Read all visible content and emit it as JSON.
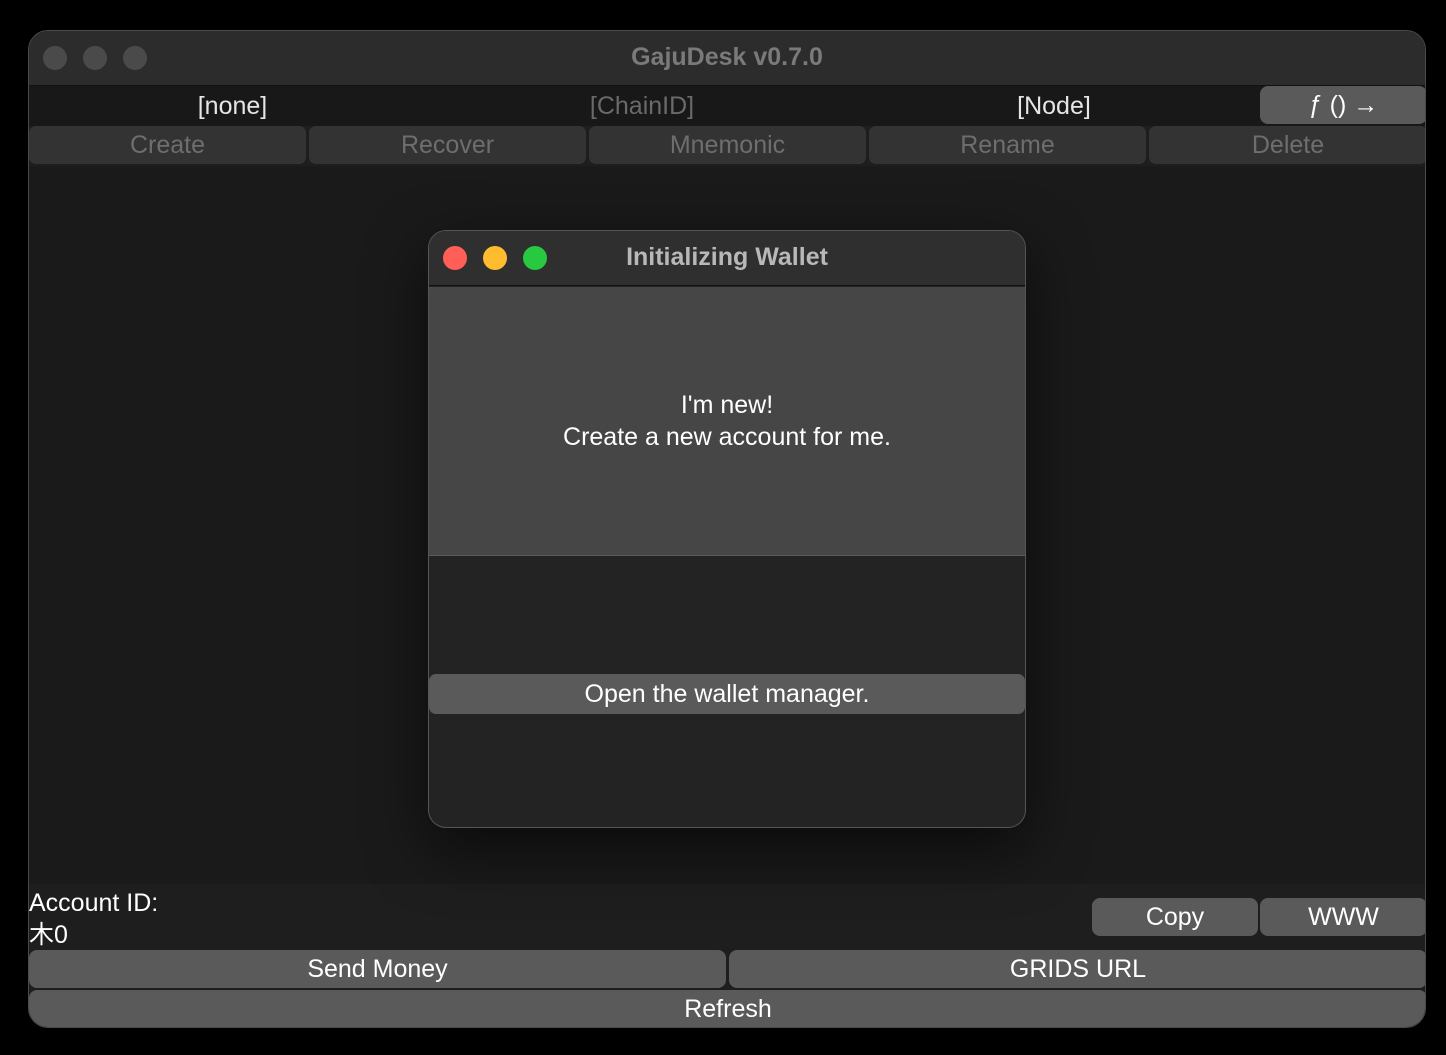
{
  "window": {
    "title": "GajuDesk v0.7.0"
  },
  "toolbar": {
    "account": "[none]",
    "chain_id": "[ChainID]",
    "node": "[Node]",
    "function_button": "ƒ () →"
  },
  "actions": [
    {
      "label": "Create"
    },
    {
      "label": "Recover"
    },
    {
      "label": "Mnemonic"
    },
    {
      "label": "Rename"
    },
    {
      "label": "Delete"
    }
  ],
  "footer": {
    "account_id_label": "Account ID:",
    "account_value": "木0",
    "copy_label": "Copy",
    "www_label": "WWW",
    "send_money_label": "Send Money",
    "grids_url_label": "GRIDS URL",
    "refresh_label": "Refresh"
  },
  "dialog": {
    "title": "Initializing Wallet",
    "new_account_line1": "I'm new!",
    "new_account_line2": "Create a new account for me.",
    "wallet_manager_label": "Open the wallet manager."
  },
  "colors": {
    "close": "#ff5f57",
    "minimize": "#febc2e",
    "maximize": "#28c840",
    "inactive_dot": "#4a4a4a"
  }
}
